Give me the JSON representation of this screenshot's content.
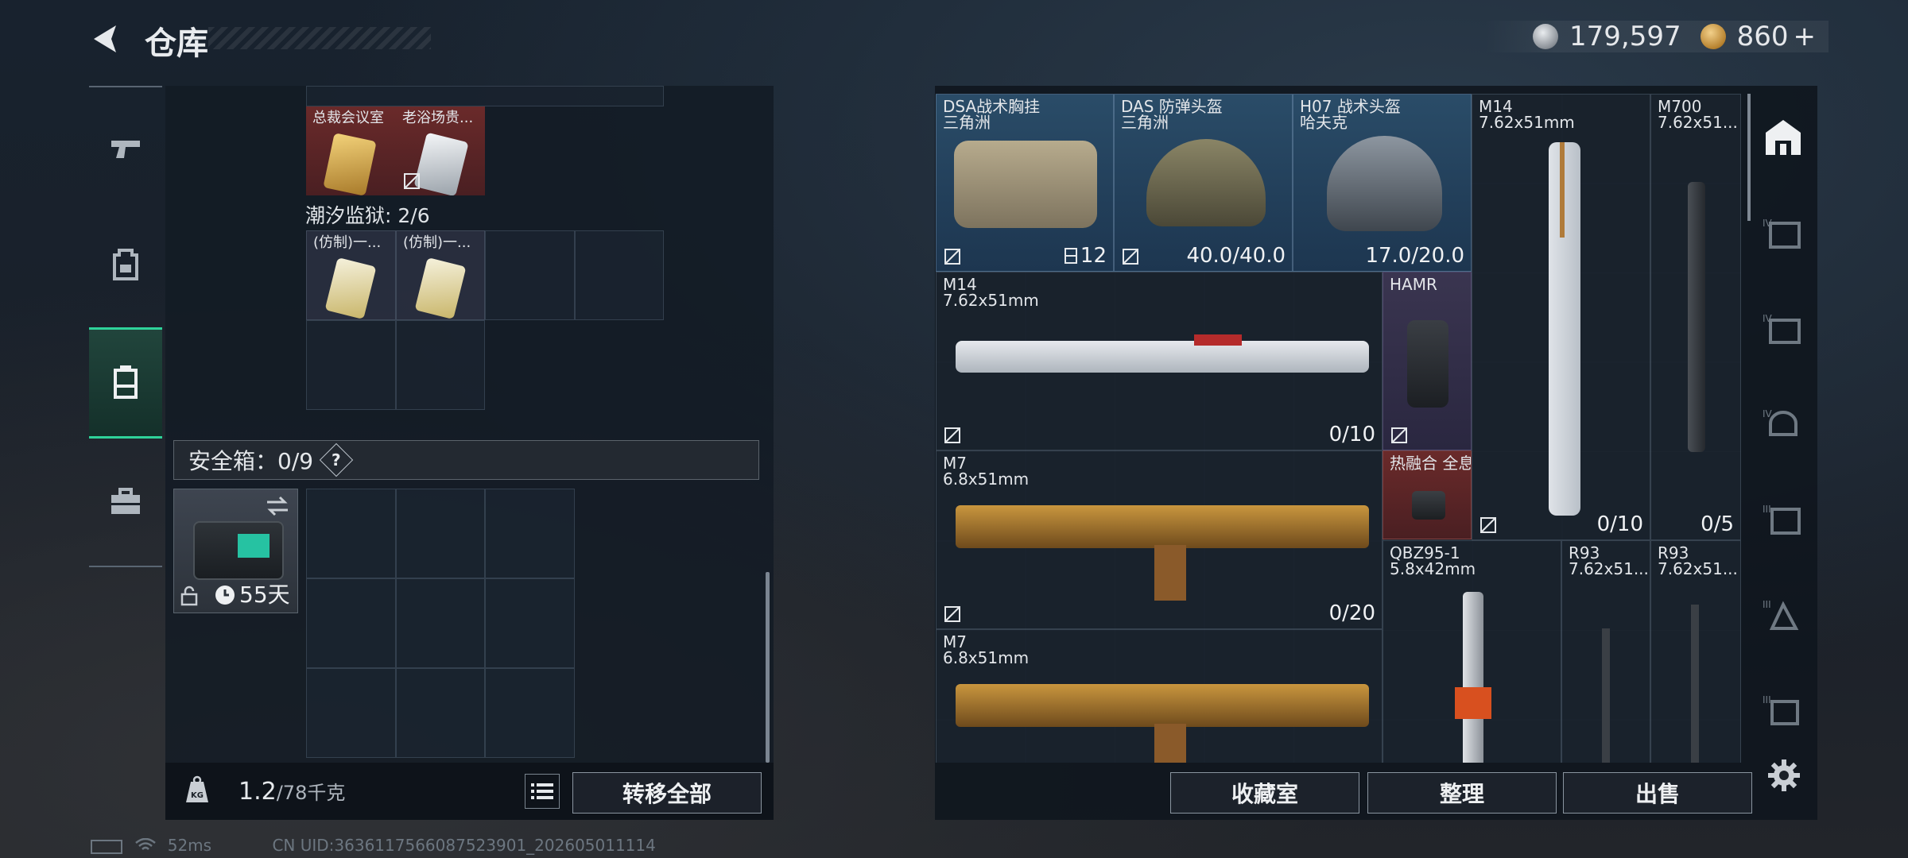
{
  "header": {
    "title": "仓库",
    "currency_silver": "179,597",
    "currency_gold": "860",
    "currency_gold_plus": "+"
  },
  "sidebar": {
    "items": [
      {
        "icon": "pistol-icon"
      },
      {
        "icon": "backpack-icon"
      },
      {
        "icon": "container-icon"
      },
      {
        "icon": "toolbox-icon"
      }
    ]
  },
  "left": {
    "keycards": [
      {
        "name": "总裁会议室"
      },
      {
        "name": "老浴场贵..."
      }
    ],
    "prison_label": "潮汐监狱: 2/6",
    "prison_cards": [
      {
        "name": "(仿制)一..."
      },
      {
        "name": "(仿制)一..."
      }
    ],
    "safebox_label": "安全箱：0/9",
    "safebox_help": "?",
    "safebox_days": "55天",
    "weight_value": "1.2",
    "weight_max": "/78千克",
    "transfer_all": "转移全部"
  },
  "right": {
    "items": [
      {
        "name": "DSA战术胸挂",
        "sub": "三角洲",
        "count": "12"
      },
      {
        "name": "DAS 防弹头盔",
        "sub": "三角洲",
        "count": "40.0/40.0"
      },
      {
        "name": "H07 战术头盔",
        "sub": "哈夫克",
        "count": "17.0/20.0"
      },
      {
        "name": "M14",
        "sub": "7.62x51mm",
        "count": "0/10"
      },
      {
        "name": "M700",
        "sub": "7.62x51...",
        "count": "0/5"
      },
      {
        "name": "M14",
        "sub": "7.62x51mm",
        "count": "0/10"
      },
      {
        "name": "HAMR",
        "sub": "",
        "count": ""
      },
      {
        "name": "M7",
        "sub": "6.8x51mm",
        "count": "0/20"
      },
      {
        "name": "热融合 全息",
        "sub": "",
        "count": ""
      },
      {
        "name": "QBZ95-1",
        "sub": "5.8x42mm",
        "count": ""
      },
      {
        "name": "R93",
        "sub": "7.62x51...",
        "count": ""
      },
      {
        "name": "R93",
        "sub": "7.62x51...",
        "count": ""
      },
      {
        "name": "M7",
        "sub": "6.8x51mm",
        "count": ""
      }
    ],
    "btn_collection": "收藏室",
    "btn_sort": "整理",
    "btn_sell": "出售"
  },
  "right_tabs": [
    {
      "icon": "warehouse-icon"
    },
    {
      "icon": "tier4-armor-icon"
    },
    {
      "icon": "tier4-vest-icon"
    },
    {
      "icon": "tier4-helmet-icon"
    },
    {
      "icon": "tier3-armor-icon"
    },
    {
      "icon": "tier3-vest-icon"
    },
    {
      "icon": "tier3-helmet-icon"
    },
    {
      "icon": "settings-gear-icon"
    }
  ],
  "footer": {
    "ping": "52ms",
    "uid": "CN UID:36361175660875239​01_202605011114"
  },
  "colors": {
    "accent_green": "#2fd29a",
    "blue_rarity": "#2a4c68",
    "red_rarity": "#6a2a2a"
  }
}
